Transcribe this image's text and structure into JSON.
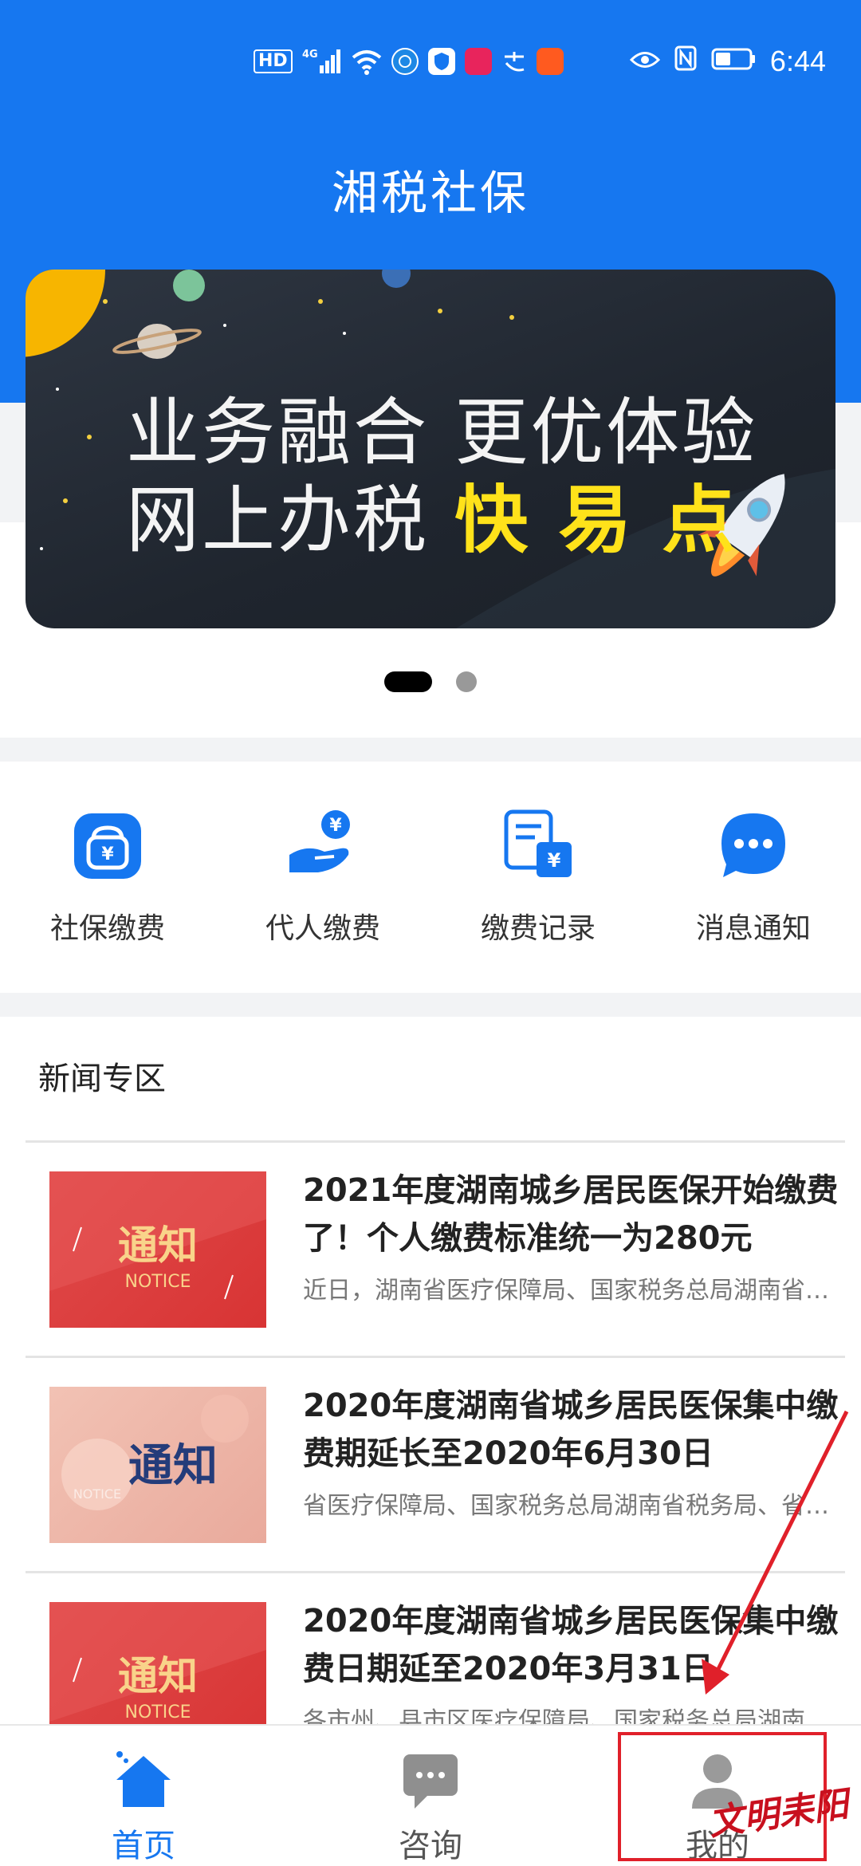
{
  "status_bar": {
    "time": "6:44",
    "left_icons": [
      "hd-icon",
      "4g-signal-icon",
      "wifi-icon",
      "vpn-icon",
      "shield-icon",
      "tmall-app-icon",
      "alipay-icon",
      "taobao-app-icon"
    ],
    "hd_label": "HD",
    "signal_label": "4G",
    "right_icons": [
      "eye-icon",
      "nfc-icon",
      "battery-icon"
    ]
  },
  "header": {
    "title": "湘税社保"
  },
  "banner": {
    "line1": "业务融合 更优体验",
    "line2_prefix": "网上办税 ",
    "line2_accent": "快易点",
    "page_count": 2,
    "active_page": 1
  },
  "actions": [
    {
      "label": "社保缴费",
      "icon": "wallet-icon"
    },
    {
      "label": "代人缴费",
      "icon": "hand-payment-icon"
    },
    {
      "label": "缴费记录",
      "icon": "payment-record-icon"
    },
    {
      "label": "消息通知",
      "icon": "message-icon"
    }
  ],
  "news": {
    "title": "新闻专区",
    "items": [
      {
        "headline": "2021年度湖南城乡居民医保开始缴费了！个人缴费标准统一为280元",
        "summary": "近日，湖南省医疗保障局、国家税务总局湖南省税...",
        "thumb_text": "通知",
        "thumb_sub": "NOTICE"
      },
      {
        "headline": "2020年度湖南省城乡居民医保集中缴费期延长至2020年6月30日",
        "summary": "省医疗保障局、国家税务总局湖南省税务局、省财...",
        "thumb_text": "通知",
        "thumb_sub": "NOTICE"
      },
      {
        "headline": "2020年度湖南省城乡居民医保集中缴费日期延至2020年3月31日",
        "summary": "各市州、县市区医疗保障局、国家税务总局湖南省...",
        "thumb_text": "通知",
        "thumb_sub": "NOTICE"
      }
    ]
  },
  "bottom_nav": [
    {
      "label": "首页",
      "icon": "home-icon",
      "active": true
    },
    {
      "label": "咨询",
      "icon": "chat-icon",
      "active": false
    },
    {
      "label": "我的",
      "icon": "user-icon",
      "active": false
    }
  ],
  "watermark": "文明耒阳",
  "colors": {
    "brand_blue": "#1677f0",
    "banner_accent": "#ffe21a",
    "annotation_red": "#e0202a"
  }
}
